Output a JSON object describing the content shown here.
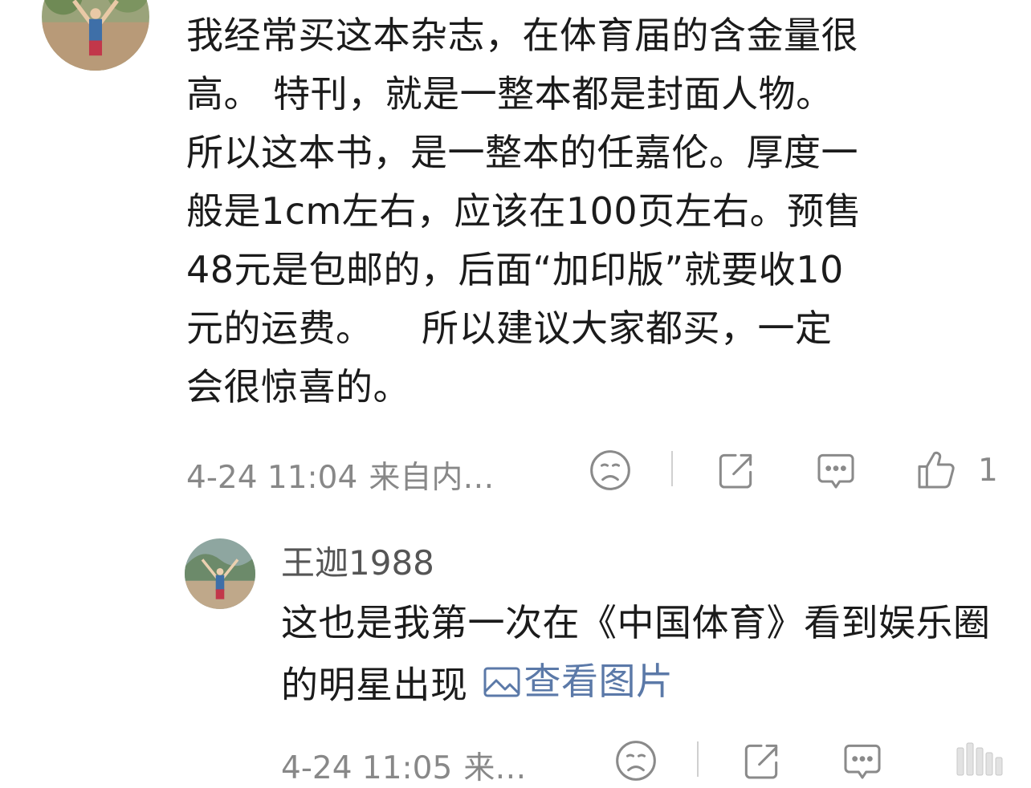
{
  "comment": {
    "text": "我经常买这本杂志，在体育届的含金量很\n高。 特刊，就是一整本都是封面人物。\n所以这本书，是一整本的任嘉伦。厚度一\n般是1cm左右，应该在100页左右。预售\n48元是包邮的，后面“加印版”就要收10\n元的运费。    所以建议大家都买，一定\n会很惊喜的。",
    "time": "4-24 11:04",
    "source": "来自内…",
    "like_count": "1"
  },
  "reply": {
    "username": "王迦1988",
    "text": "这也是我第一次在《中国体育》看到娱乐圈的明星出现",
    "view_image_label": "查看图片",
    "time": "4-24 11:05",
    "source": "来…"
  },
  "icons": {
    "dislike": "sad-face-icon",
    "share": "share-icon",
    "reply": "comment-bubble-icon",
    "like": "thumbs-up-icon",
    "image": "picture-icon"
  },
  "colors": {
    "meta_gray": "#888888",
    "link_blue": "#5b79a8",
    "text": "#1b1b1b"
  }
}
